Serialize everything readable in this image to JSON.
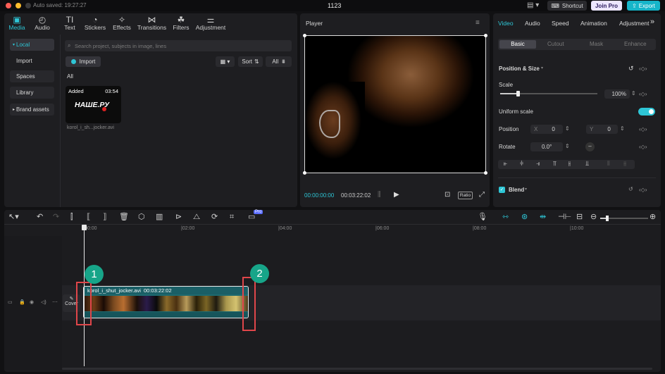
{
  "window": {
    "title": "1123",
    "autosave": "Auto saved: 19:27:27",
    "shortcut": "Shortcut",
    "join_pro": "Join Pro",
    "export": "Export"
  },
  "media_tabs": [
    {
      "label": "Media",
      "icon": "media-icon"
    },
    {
      "label": "Audio",
      "icon": "audio-icon"
    },
    {
      "label": "Text",
      "icon": "text-icon"
    },
    {
      "label": "Stickers",
      "icon": "stickers-icon"
    },
    {
      "label": "Effects",
      "icon": "effects-icon"
    },
    {
      "label": "Transitions",
      "icon": "transitions-icon"
    },
    {
      "label": "Filters",
      "icon": "filters-icon"
    },
    {
      "label": "Adjustment",
      "icon": "adjustment-icon"
    }
  ],
  "sidebar": {
    "items": [
      "Local",
      "Import",
      "Spaces",
      "Library",
      "Brand assets"
    ]
  },
  "media": {
    "search_placeholder": "Search project, subjects in image, lines",
    "import": "Import",
    "sort": "Sort",
    "all_filter": "All",
    "all_heading": "All",
    "clip": {
      "status": "Added",
      "duration": "03:54",
      "thumb_text": "НАШЕ.РУ",
      "filename": "korol_i_sh...jocker.avi"
    }
  },
  "player": {
    "title": "Player",
    "current_time": "00:00:00:00",
    "total_time": "00:03:22:02",
    "ratio": "Ratio"
  },
  "props": {
    "tabs": [
      "Video",
      "Audio",
      "Speed",
      "Animation",
      "Adjustment"
    ],
    "subtabs": [
      "Basic",
      "Cutout",
      "Mask",
      "Enhance"
    ],
    "position_size": "Position & Size",
    "scale_label": "Scale",
    "scale_value": "100%",
    "scale_fraction": 1.0,
    "uniform_scale": "Uniform scale",
    "position_label": "Position",
    "x_label": "X",
    "x_value": "0",
    "y_label": "Y",
    "y_value": "0",
    "rotate_label": "Rotate",
    "rotate_value": "0.0°",
    "blend": "Blend"
  },
  "timeline": {
    "ruler": [
      "00:00",
      "|02:00",
      "|04:00",
      "|06:00",
      "|08:00",
      "|10:00"
    ],
    "clip": {
      "name": "korol_i_shut_jocker.avi",
      "duration": "00:03:22:02"
    },
    "cover": "Cover",
    "badges": [
      "1",
      "2"
    ],
    "pro_tag": "Pro"
  }
}
